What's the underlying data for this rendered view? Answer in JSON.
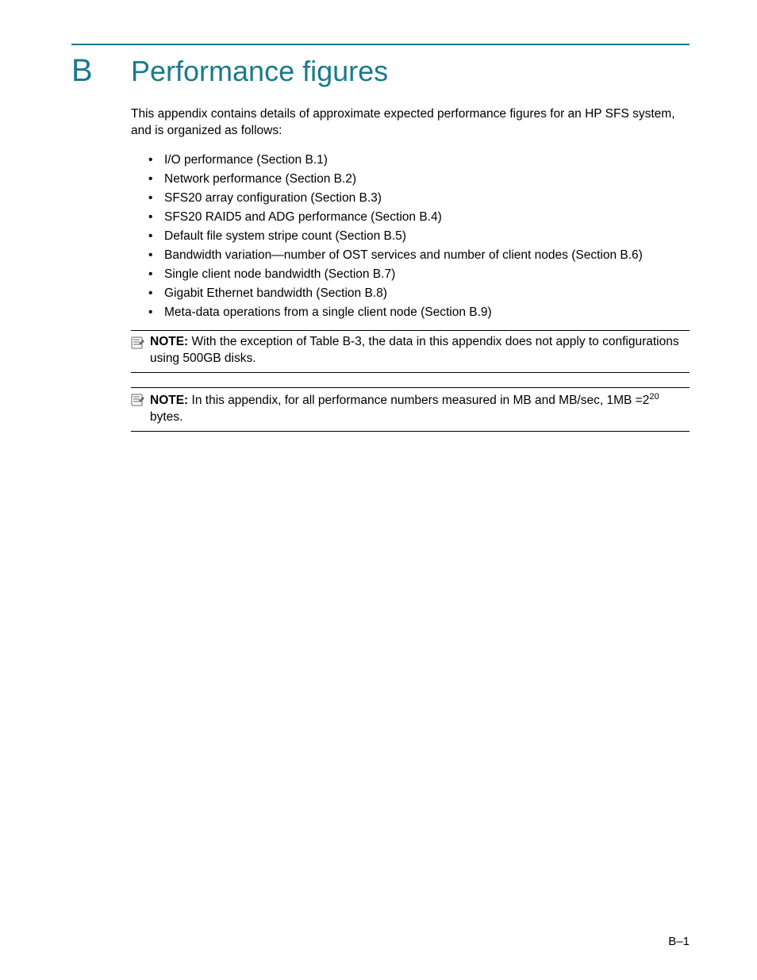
{
  "heading": {
    "letter": "B",
    "title": "Performance figures"
  },
  "intro": "This appendix contains details of approximate expected performance figures for an HP SFS system, and is organized as follows:",
  "toc": [
    "I/O performance (Section B.1)",
    "Network performance (Section B.2)",
    "SFS20 array configuration (Section B.3)",
    "SFS20 RAID5 and ADG performance (Section B.4)",
    "Default file system stripe count (Section B.5)",
    "Bandwidth variation—number of OST services and number of client nodes (Section B.6)",
    "Single client node bandwidth (Section B.7)",
    "Gigabit Ethernet bandwidth (Section B.8)",
    "Meta-data operations from a single client node (Section B.9)"
  ],
  "notes": [
    {
      "label": "NOTE:",
      "text": "With the exception of Table B-3, the data in this appendix does not apply to configurations using 500GB disks."
    },
    {
      "label": "NOTE:",
      "text_prefix": "In this appendix, for all performance numbers measured in MB and MB/sec, 1MB =2",
      "text_sup": "20",
      "text_suffix": " bytes."
    }
  ],
  "page_number": "B–1"
}
